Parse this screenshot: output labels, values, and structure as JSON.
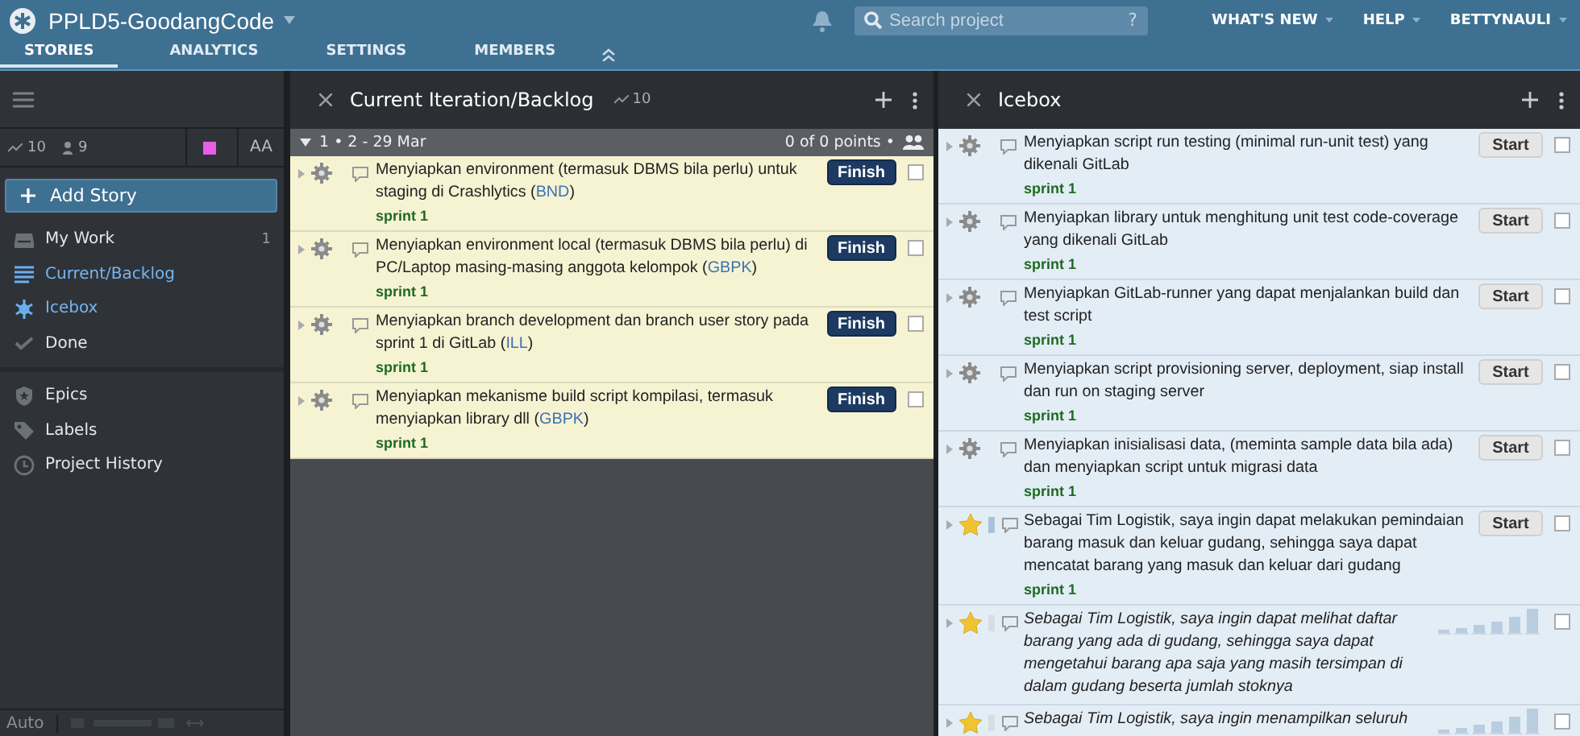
{
  "header": {
    "project": "PPLD5-GoodangCode",
    "search": {
      "placeholder": "Search project"
    },
    "search_help": "?",
    "menus": [
      "WHAT'S NEW",
      "HELP",
      "BETTYNAULI"
    ]
  },
  "tabs": [
    {
      "label": "STORIES",
      "selected": true
    },
    {
      "label": "ANALYTICS",
      "selected": false
    },
    {
      "label": "SETTINGS",
      "selected": false
    },
    {
      "label": "MEMBERS",
      "selected": false
    }
  ],
  "sidebar": {
    "velocity": "10",
    "members": "9",
    "font_size": "AA",
    "add_story": "Add Story",
    "groups": [
      [
        {
          "label": "My Work",
          "count": "1",
          "selected": false
        },
        {
          "label": "Current/Backlog",
          "selected": true
        },
        {
          "label": "Icebox",
          "selected": true
        },
        {
          "label": "Done",
          "selected": false
        }
      ],
      [
        {
          "label": "Epics",
          "selected": false
        },
        {
          "label": "Labels",
          "selected": false
        },
        {
          "label": "Project History",
          "selected": false
        }
      ]
    ],
    "footer": "Auto"
  },
  "panels": [
    {
      "title": "Current Iteration/Backlog",
      "velocity": "10",
      "iteration": {
        "label": "1 • 2 - 29 Mar",
        "points": "0 of 0 points •"
      },
      "stories": [
        {
          "kind": "chore",
          "text": "Menyiapkan environment (termasuk DBMS bila perlu) untuk staging di Crashlytics (",
          "owner": "BND",
          "text_after": ")",
          "label": "sprint 1",
          "action": "Finish",
          "checked": false
        },
        {
          "kind": "chore",
          "text": "Menyiapkan environment local (termasuk DBMS bila perlu) di PC/Laptop masing-masing anggota kelompok (",
          "owner": "GBPK",
          "text_after": ")",
          "label": "sprint 1",
          "action": "Finish",
          "checked": false
        },
        {
          "kind": "chore",
          "text": "Menyiapkan branch development dan branch user story pada sprint 1 di GitLab (",
          "owner": "ILL",
          "text_after": ")",
          "label": "sprint 1",
          "action": "Finish",
          "checked": false
        },
        {
          "kind": "chore",
          "text": "Menyiapkan mekanisme build script kompilasi, termasuk menyiapkan library dll (",
          "owner": "GBPK",
          "text_after": ")",
          "label": "sprint 1",
          "action": "Finish",
          "checked": false
        }
      ]
    },
    {
      "title": "Icebox",
      "stories": [
        {
          "kind": "chore",
          "text": "Menyiapkan script run testing (minimal run-unit test) yang dikenali GitLab",
          "label": "sprint 1",
          "action": "Start",
          "checked": false
        },
        {
          "kind": "chore",
          "text": "Menyiapkan library untuk menghitung unit test code-coverage yang dikenali GitLab",
          "label": "sprint 1",
          "action": "Start",
          "checked": false
        },
        {
          "kind": "chore",
          "text": "Menyiapkan GitLab-runner yang dapat menjalankan build dan test script",
          "label": "sprint 1",
          "action": "Start",
          "checked": false
        },
        {
          "kind": "chore",
          "text": "Menyiapkan script provisioning server, deployment, siap install dan run on staging server",
          "label": "sprint 1",
          "action": "Start",
          "checked": false
        },
        {
          "kind": "chore",
          "text": "Menyiapkan inisialisasi data, (meminta sample data bila ada) dan menyiapkan script untuk migrasi data",
          "label": "sprint 1",
          "action": "Start",
          "checked": false
        },
        {
          "kind": "feature",
          "text": "Sebagai Tim Logistik, saya ingin dapat melakukan pemindaian barang masuk dan keluar gudang, sehingga saya dapat mencatat barang yang masuk dan keluar dari gudang",
          "label": "sprint 1",
          "action": "Start",
          "estimated": true,
          "checked": false
        },
        {
          "kind": "feature",
          "text": "Sebagai Tim Logistik, saya ingin dapat melihat daftar barang yang ada di gudang, sehingga saya dapat mengetahui barang apa saja yang masih tersimpan di dalam gudang beserta jumlah stoknya",
          "estimated": false,
          "checked": false
        },
        {
          "kind": "feature",
          "text": "Sebagai Tim Logistik, saya ingin menampilkan seluruh",
          "estimated": false,
          "checked": false
        }
      ]
    }
  ]
}
